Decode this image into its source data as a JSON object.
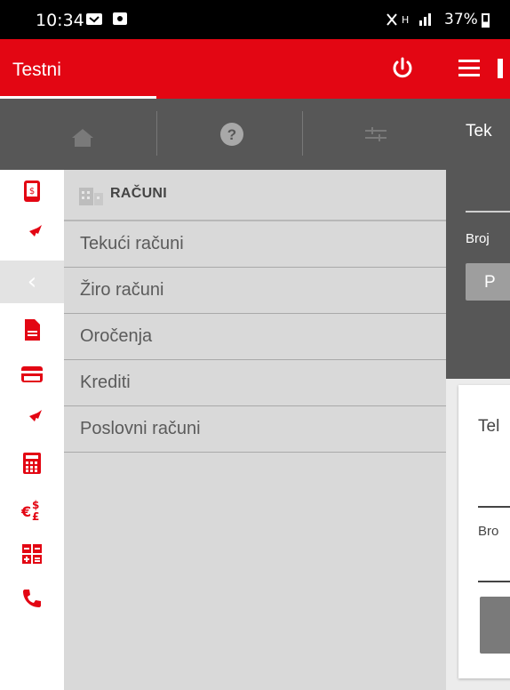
{
  "status_bar": {
    "time": "10:34",
    "signal_text": "✕ ↑↓ .∣∣",
    "battery": "37%"
  },
  "drawer": {
    "title": "Testni",
    "tabs": [
      "home-icon",
      "help-icon",
      "settings-sliders-icon"
    ],
    "section_title": "RAČUNI",
    "items": [
      {
        "label": "Tekući računi"
      },
      {
        "label": "Žiro računi"
      },
      {
        "label": "Oročenja"
      },
      {
        "label": "Krediti"
      },
      {
        "label": "Poslovni računi"
      }
    ]
  },
  "rail_icons": [
    "accounts-phone-icon",
    "transfer-icon",
    "back-chevron-icon",
    "document-icon",
    "card-icon",
    "transfer-icon",
    "calculator-icon",
    "currency-exchange-icon",
    "calc-grid-icon",
    "phone-icon"
  ],
  "content": {
    "title_partial": "Tek",
    "label1": "Broj",
    "button_partial": "P",
    "card_title_partial": "Tel",
    "card_label_partial": "Bro"
  },
  "colors": {
    "brand_red": "#e30613",
    "dark_gray": "#575757",
    "drawer_bg": "#d9d9d9"
  }
}
